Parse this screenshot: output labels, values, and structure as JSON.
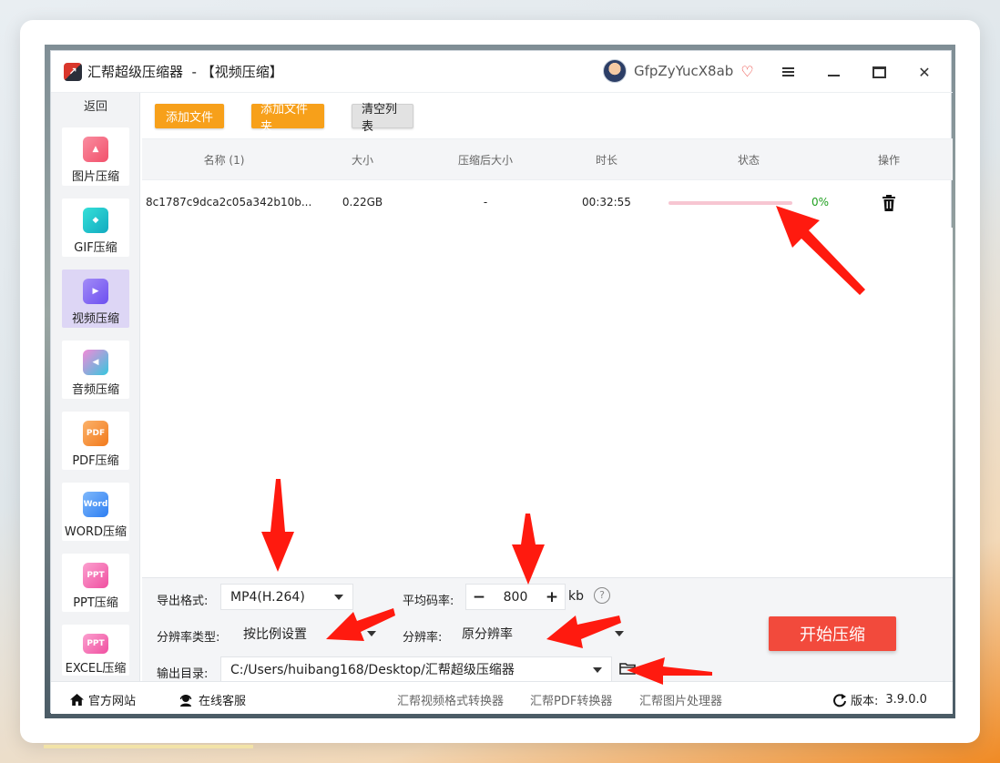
{
  "window": {
    "app_name": "汇帮超级压缩器",
    "separator": "  - ",
    "section_title": "【视频压缩】",
    "username": "GfpZyYucX8ab"
  },
  "sidebar": {
    "back_label": "返回",
    "items": [
      {
        "label": "图片压缩",
        "color": "#f7637a"
      },
      {
        "label": "GIF压缩",
        "color": "#19c7c4"
      },
      {
        "label": "视频压缩",
        "color": "#8a6cf2"
      },
      {
        "label": "音频压缩",
        "color": "#3fc4d8"
      },
      {
        "label": "PDF压缩",
        "color": "#f78a2a",
        "badge": "PDF"
      },
      {
        "label": "WORD压缩",
        "color": "#3a8ef6",
        "badge": "Word"
      },
      {
        "label": "PPT压缩",
        "color": "#f760a8",
        "badge": "PPT"
      },
      {
        "label": "EXCEL压缩",
        "color": "#f760a8",
        "badge": "PPT"
      }
    ],
    "active_index": 2
  },
  "toolbar": {
    "add_file_label": "添加文件",
    "add_folder_label": "添加文件夹",
    "clear_list_label": "清空列表"
  },
  "table": {
    "headers": {
      "name": "名称 (1)",
      "size": "大小",
      "compressed_size": "压缩后大小",
      "duration": "时长",
      "status": "状态",
      "action": "操作"
    },
    "rows": [
      {
        "name": "8c1787c9dca2c05a342b10b...",
        "size": "0.22GB",
        "compressed_size": "-",
        "duration": "00:32:55",
        "progress": 0,
        "progress_label": "0%"
      }
    ]
  },
  "settings": {
    "format_label": "导出格式:",
    "format_value": "MP4(H.264)",
    "bitrate_label": "平均码率:",
    "bitrate_value": "800",
    "bitrate_unit": "kb",
    "bitrate_minus": "−",
    "bitrate_plus": "+",
    "help_glyph": "?",
    "res_type_label": "分辨率类型:",
    "res_type_value": "按比例设置",
    "res_label": "分辨率:",
    "res_value": "原分辨率",
    "output_label": "输出目录:",
    "output_value": "C:/Users/huibang168/Desktop/汇帮超级压缩器",
    "start_label": "开始压缩"
  },
  "footer": {
    "website_label": "官方网站",
    "support_label": "在线客服",
    "link_video_converter": "汇帮视频格式转换器",
    "link_pdf_converter": "汇帮PDF转换器",
    "link_image_processor": "汇帮图片处理器",
    "version_label": "版本:",
    "version_value": "3.9.0.0"
  },
  "colors": {
    "accent_orange": "#f7a01a",
    "start_red": "#f24a3c",
    "progress_track": "#f7c6d2",
    "annotation_arrow": "#ff1a0f"
  }
}
